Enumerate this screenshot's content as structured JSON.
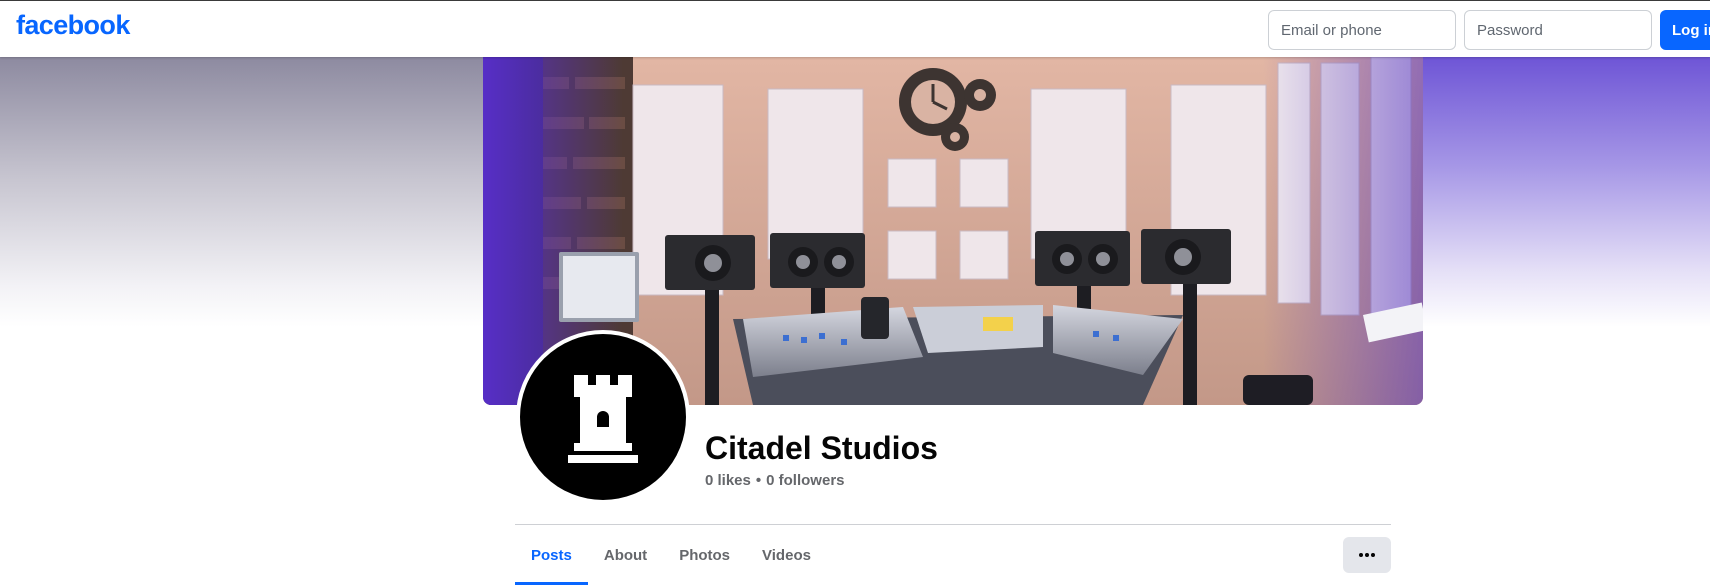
{
  "header": {
    "logo_text": "facebook",
    "email_placeholder": "Email or phone",
    "password_placeholder": "Password",
    "login_label": "Log in"
  },
  "profile": {
    "name": "Citadel Studios",
    "likes": "0 likes",
    "separator": "•",
    "followers": "0 followers",
    "avatar_icon": "castle-tower-icon"
  },
  "tabs": [
    {
      "label": "Posts",
      "active": true
    },
    {
      "label": "About",
      "active": false
    },
    {
      "label": "Photos",
      "active": false
    },
    {
      "label": "Videos",
      "active": false
    }
  ],
  "more_icon": "more-dots-icon",
  "colors": {
    "brand": "#0866ff",
    "secondary_text": "#65676b",
    "avatar_bg": "#000000"
  }
}
